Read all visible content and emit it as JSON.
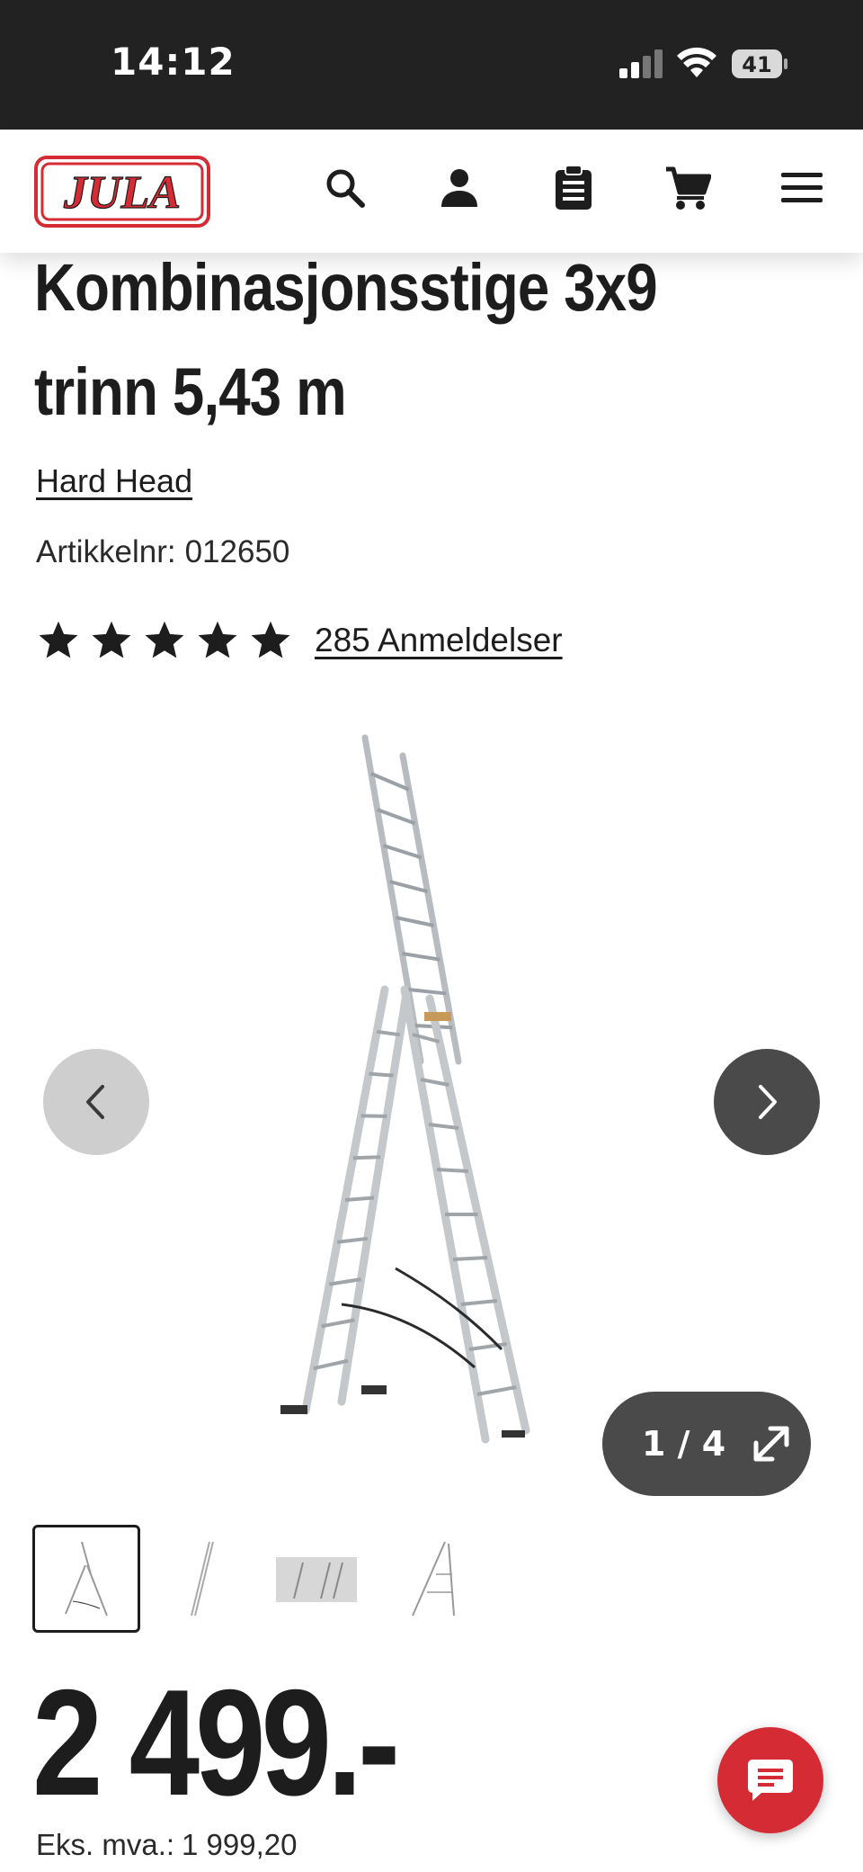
{
  "status_bar": {
    "time": "14:12",
    "battery_level": "41"
  },
  "header": {
    "logo_text": "JULA",
    "icons": [
      "search-icon",
      "account-icon",
      "clipboard-icon",
      "cart-icon",
      "menu-icon"
    ]
  },
  "product": {
    "title_line1": "Kombinasjonsstige 3x9",
    "title_line2": "trinn 5,43 m",
    "brand": "Hard Head",
    "article_label": "Artikkelnr:",
    "article_number": "012650",
    "rating": 5,
    "rating_max": 5,
    "reviews_text": "285 Anmeldelser"
  },
  "gallery": {
    "counter": "1 / 4",
    "current_image": 1,
    "total_images": 4,
    "prev_icon": "chevron-left-icon",
    "next_icon": "chevron-right-icon",
    "expand_icon": "expand-icon"
  },
  "pricing": {
    "price": "2 499.-",
    "vat_label": "Eks. mva.:",
    "vat_value": "1 999,20"
  },
  "colors": {
    "brand_red": "#d42b35",
    "status_bar_bg": "#222222",
    "text": "#1d1d1d",
    "dark_button": "#4a4a4a",
    "light_button": "#cecece"
  }
}
